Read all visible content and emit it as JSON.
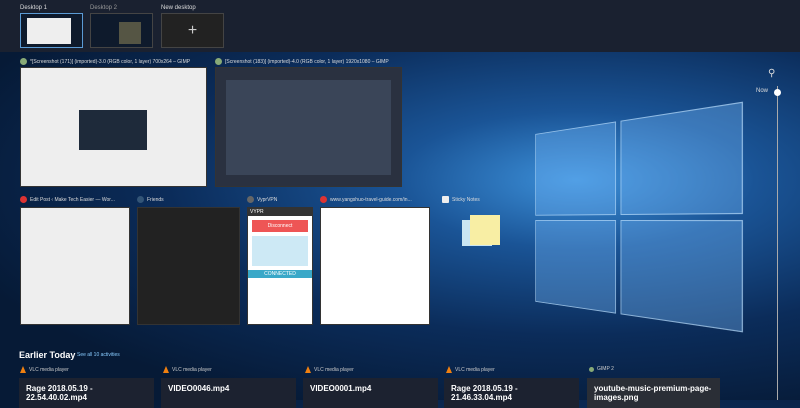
{
  "desktops": [
    {
      "label": "Desktop 1"
    },
    {
      "label": "Desktop 2"
    },
    {
      "label": "New desktop",
      "icon": "plus-icon"
    }
  ],
  "windows": [
    {
      "title": "*[Screenshot (171)] (imported)-3.0 (RGB color, 1 layer) 700x264 – GIMP",
      "icon": "gimp-icon"
    },
    {
      "title": "[Screenshot (183)] (imported)-4.0 (RGB color, 1 layer) 1920x1080 – GIMP",
      "icon": "gimp-icon"
    },
    {
      "title": "Edit Post ‹ Make Tech Easier — Wor...",
      "icon": "chrome-icon"
    },
    {
      "title": "Friends",
      "icon": "steam-icon"
    },
    {
      "title": "VyprVPN",
      "icon": "vyprvpn-icon"
    },
    {
      "title": "www.yangshuo-travel-guide.com/in...",
      "icon": "chrome-icon"
    },
    {
      "title": "Sticky Notes",
      "icon": "sticky-notes-icon"
    }
  ],
  "vpn": {
    "brand": "VYPR",
    "button": "Disconnect",
    "status": "CONNECTED"
  },
  "timeline": {
    "now_label": "Now",
    "section": "Earlier Today",
    "see_all": "See all 10 activities"
  },
  "activities": [
    {
      "app": "VLC media player",
      "title": "Rage 2018.05.19 - 22.54.40.02.mp4"
    },
    {
      "app": "VLC media player",
      "title": "VIDEO0046.mp4"
    },
    {
      "app": "VLC media player",
      "title": "VIDEO0001.mp4"
    },
    {
      "app": "VLC media player",
      "title": "Rage 2018.05.19 - 21.46.33.04.mp4"
    },
    {
      "app": "GIMP 2",
      "title": "youtube-music-premium-page-images.png"
    }
  ]
}
